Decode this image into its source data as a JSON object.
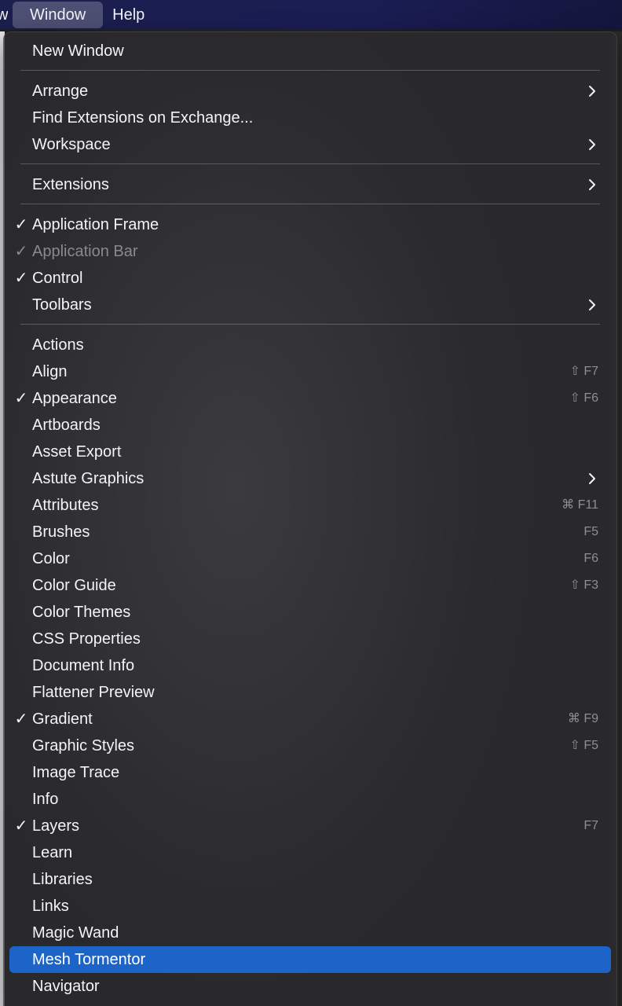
{
  "menubar": {
    "prev_item_partial": "w",
    "active_menu": "Window",
    "next_item": "Help"
  },
  "colors": {
    "highlight": "#1d64c8",
    "menu_bg": "#2c2c2e",
    "menubar_bg": "#1b1f4e"
  },
  "menu": {
    "items": [
      {
        "label": "New Window",
        "checked": false,
        "disabled": false,
        "shortcut": "",
        "submenu": false
      },
      {
        "label": "Arrange",
        "checked": false,
        "disabled": false,
        "shortcut": "",
        "submenu": true
      },
      {
        "label": "Find Extensions on Exchange...",
        "checked": false,
        "disabled": false,
        "shortcut": "",
        "submenu": false
      },
      {
        "label": "Workspace",
        "checked": false,
        "disabled": false,
        "shortcut": "",
        "submenu": true
      },
      {
        "label": "Extensions",
        "checked": false,
        "disabled": false,
        "shortcut": "",
        "submenu": true
      },
      {
        "label": "Application Frame",
        "checked": true,
        "disabled": false,
        "shortcut": "",
        "submenu": false
      },
      {
        "label": "Application Bar",
        "checked": true,
        "disabled": true,
        "shortcut": "",
        "submenu": false
      },
      {
        "label": "Control",
        "checked": true,
        "disabled": false,
        "shortcut": "",
        "submenu": false
      },
      {
        "label": "Toolbars",
        "checked": false,
        "disabled": false,
        "shortcut": "",
        "submenu": true
      },
      {
        "label": "Actions",
        "checked": false,
        "disabled": false,
        "shortcut": "",
        "submenu": false
      },
      {
        "label": "Align",
        "checked": false,
        "disabled": false,
        "shortcut": "⇧ F7",
        "submenu": false
      },
      {
        "label": "Appearance",
        "checked": true,
        "disabled": false,
        "shortcut": "⇧ F6",
        "submenu": false
      },
      {
        "label": "Artboards",
        "checked": false,
        "disabled": false,
        "shortcut": "",
        "submenu": false
      },
      {
        "label": "Asset Export",
        "checked": false,
        "disabled": false,
        "shortcut": "",
        "submenu": false
      },
      {
        "label": "Astute Graphics",
        "checked": false,
        "disabled": false,
        "shortcut": "",
        "submenu": true
      },
      {
        "label": "Attributes",
        "checked": false,
        "disabled": false,
        "shortcut": "⌘ F11",
        "submenu": false
      },
      {
        "label": "Brushes",
        "checked": false,
        "disabled": false,
        "shortcut": "F5",
        "submenu": false
      },
      {
        "label": "Color",
        "checked": false,
        "disabled": false,
        "shortcut": "F6",
        "submenu": false
      },
      {
        "label": "Color Guide",
        "checked": false,
        "disabled": false,
        "shortcut": "⇧ F3",
        "submenu": false
      },
      {
        "label": "Color Themes",
        "checked": false,
        "disabled": false,
        "shortcut": "",
        "submenu": false
      },
      {
        "label": "CSS Properties",
        "checked": false,
        "disabled": false,
        "shortcut": "",
        "submenu": false
      },
      {
        "label": "Document Info",
        "checked": false,
        "disabled": false,
        "shortcut": "",
        "submenu": false
      },
      {
        "label": "Flattener Preview",
        "checked": false,
        "disabled": false,
        "shortcut": "",
        "submenu": false
      },
      {
        "label": "Gradient",
        "checked": true,
        "disabled": false,
        "shortcut": "⌘ F9",
        "submenu": false
      },
      {
        "label": "Graphic Styles",
        "checked": false,
        "disabled": false,
        "shortcut": "⇧ F5",
        "submenu": false
      },
      {
        "label": "Image Trace",
        "checked": false,
        "disabled": false,
        "shortcut": "",
        "submenu": false
      },
      {
        "label": "Info",
        "checked": false,
        "disabled": false,
        "shortcut": "",
        "submenu": false
      },
      {
        "label": "Layers",
        "checked": true,
        "disabled": false,
        "shortcut": "F7",
        "submenu": false
      },
      {
        "label": "Learn",
        "checked": false,
        "disabled": false,
        "shortcut": "",
        "submenu": false
      },
      {
        "label": "Libraries",
        "checked": false,
        "disabled": false,
        "shortcut": "",
        "submenu": false
      },
      {
        "label": "Links",
        "checked": false,
        "disabled": false,
        "shortcut": "",
        "submenu": false
      },
      {
        "label": "Magic Wand",
        "checked": false,
        "disabled": false,
        "shortcut": "",
        "submenu": false
      },
      {
        "label": "Mesh Tormentor",
        "checked": false,
        "disabled": false,
        "shortcut": "",
        "submenu": false,
        "highlighted": true
      },
      {
        "label": "Navigator",
        "checked": false,
        "disabled": false,
        "shortcut": "",
        "submenu": false
      }
    ]
  }
}
